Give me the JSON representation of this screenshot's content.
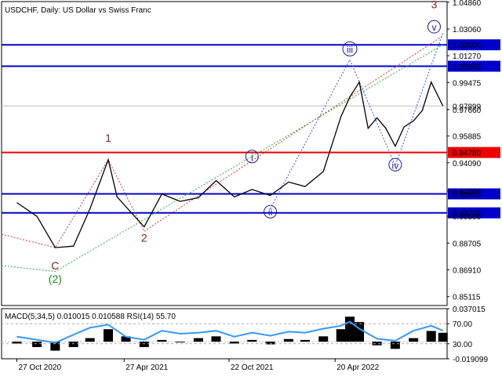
{
  "chart_data": {
    "type": "line",
    "title": "USDCHF, Daily:  US Dollar vs Swiss Franc",
    "ylim": [
      0.8452,
      1.049
    ],
    "y_ticks": [
      "1.04860",
      "1.03060",
      "1.01270",
      "0.99475",
      "0.97660",
      "0.95885",
      "0.94090",
      "0.92200",
      "0.90500",
      "0.88705",
      "0.86910",
      "0.85115"
    ],
    "x_ticks": [
      "27 Oct 2020",
      "27 Apr 2021",
      "22 Oct 2021",
      "20 Apr 2022"
    ],
    "price_series": {
      "name": "USDCHF",
      "x": [
        "2020-10-27",
        "2020-11-30",
        "2020-12-31",
        "2021-01-31",
        "2021-02-28",
        "2021-03-31",
        "2021-04-15",
        "2021-05-31",
        "2021-06-30",
        "2021-07-31",
        "2021-08-31",
        "2021-09-30",
        "2021-10-31",
        "2021-11-30",
        "2021-12-31",
        "2022-01-31",
        "2022-02-28",
        "2022-03-31",
        "2022-04-30",
        "2022-05-15",
        "2022-05-31",
        "2022-06-15",
        "2022-06-30",
        "2022-07-15",
        "2022-07-31",
        "2022-08-15",
        "2022-08-31",
        "2022-09-15",
        "2022-09-30",
        "2022-10-20"
      ],
      "y": [
        0.9142,
        0.905,
        0.884,
        0.885,
        0.91,
        0.943,
        0.918,
        0.898,
        0.92,
        0.915,
        0.9175,
        0.929,
        0.918,
        0.923,
        0.919,
        0.928,
        0.925,
        0.935,
        0.972,
        0.985,
        0.995,
        0.964,
        0.971,
        0.964,
        0.952,
        0.965,
        0.969,
        0.976,
        0.995,
        0.979
      ]
    },
    "horizontal_levels": [
      {
        "value": "1.02000",
        "color": "#0000cc"
      },
      {
        "value": "1.00565",
        "color": "#0000cc"
      },
      {
        "value": "0.97899",
        "color": "#c0c0c0"
      },
      {
        "value": "0.94780",
        "color": "#ee0000"
      },
      {
        "value": "0.92005",
        "color": "#0000cc"
      },
      {
        "value": "0.90733",
        "color": "#0000cc"
      }
    ],
    "wave_labels": [
      {
        "label": "3",
        "color": "#8b1a1a",
        "date": "2022-10-05",
        "price": 1.045
      },
      {
        "label": "v",
        "color": "#1a1aa0",
        "circled": true,
        "date": "2022-10-05",
        "price": 1.03
      },
      {
        "label": "iii",
        "color": "#1a1aa0",
        "circled": true,
        "date": "2022-05-15",
        "price": 1.0152
      },
      {
        "label": "1",
        "color": "#8b1a1a",
        "date": "2021-03-31",
        "price": 0.9555
      },
      {
        "label": "i",
        "color": "#1a1aa0",
        "circled": true,
        "date": "2021-11-30",
        "price": 0.943
      },
      {
        "label": "iv",
        "color": "#1a1aa0",
        "circled": true,
        "date": "2022-07-31",
        "price": 0.9375
      },
      {
        "label": "ii",
        "color": "#1a1aa0",
        "circled": true,
        "date": "2021-12-31",
        "price": 0.906
      },
      {
        "label": "2",
        "color": "#8b1a1a",
        "date": "2021-05-31",
        "price": 0.8885
      },
      {
        "label": "C",
        "color": "#8b1a1a",
        "date": "2020-12-31",
        "price": 0.87
      },
      {
        "label": "(2)",
        "color": "#1a8b1a",
        "date": "2020-12-31",
        "price": 0.861
      }
    ],
    "wave_lines": [
      {
        "color": "#cc3333",
        "points": [
          [
            "2020-10-01",
            0.893
          ],
          [
            "2020-12-31",
            0.884
          ],
          [
            "2021-03-31",
            0.943
          ],
          [
            "2021-05-31",
            0.895
          ],
          [
            "2022-10-20",
            1.026
          ]
        ]
      },
      {
        "color": "#33aa33",
        "points": [
          [
            "2020-10-01",
            0.872
          ],
          [
            "2020-12-31",
            0.868
          ],
          [
            "2022-10-20",
            1.02
          ]
        ]
      },
      {
        "color": "#3355cc",
        "points": [
          [
            "2021-12-31",
            0.91
          ],
          [
            "2022-05-15",
            1.01
          ],
          [
            "2022-07-31",
            0.939
          ],
          [
            "2022-10-20",
            1.028
          ]
        ]
      }
    ],
    "sub_chart": {
      "label": "MACD(5,34,5) 0.010015 0.010588 RSI(14) 55.70",
      "y_ticks": [
        "0.037015",
        "70.00",
        "30.00",
        "-0.019099"
      ],
      "ylim": [
        -0.0191,
        0.037
      ],
      "hist_x": [
        "2020-10-27",
        "2020-11-30",
        "2020-12-31",
        "2021-01-31",
        "2021-02-28",
        "2021-03-31",
        "2021-04-30",
        "2021-05-31",
        "2021-06-30",
        "2021-07-31",
        "2021-08-31",
        "2021-09-30",
        "2021-10-31",
        "2021-11-30",
        "2021-12-31",
        "2022-01-31",
        "2022-02-28",
        "2022-03-31",
        "2022-04-30",
        "2022-05-15",
        "2022-05-31",
        "2022-06-30",
        "2022-07-31",
        "2022-08-31",
        "2022-09-30",
        "2022-10-20"
      ],
      "hist_y": [
        -0.002,
        -0.006,
        -0.01,
        -0.006,
        0.004,
        0.014,
        0.006,
        -0.006,
        0.002,
        0.0,
        0.004,
        0.006,
        -0.002,
        0.002,
        -0.003,
        0.003,
        0.002,
        0.006,
        0.014,
        0.028,
        0.022,
        -0.004,
        -0.008,
        0.004,
        0.012,
        0.01
      ],
      "rsi_x": [
        "2020-10-27",
        "2020-11-30",
        "2020-12-31",
        "2021-01-31",
        "2021-02-28",
        "2021-03-31",
        "2021-04-30",
        "2021-05-31",
        "2021-06-30",
        "2021-07-31",
        "2021-08-31",
        "2021-09-30",
        "2021-10-31",
        "2021-11-30",
        "2021-12-31",
        "2022-01-31",
        "2022-02-28",
        "2022-03-31",
        "2022-04-30",
        "2022-05-15",
        "2022-05-31",
        "2022-06-30",
        "2022-07-31",
        "2022-08-31",
        "2022-09-30",
        "2022-10-20"
      ],
      "rsi_y": [
        44,
        38,
        32,
        48,
        62,
        68,
        44,
        38,
        56,
        50,
        52,
        56,
        44,
        52,
        46,
        54,
        52,
        60,
        66,
        74,
        60,
        40,
        36,
        56,
        66,
        56
      ]
    }
  }
}
